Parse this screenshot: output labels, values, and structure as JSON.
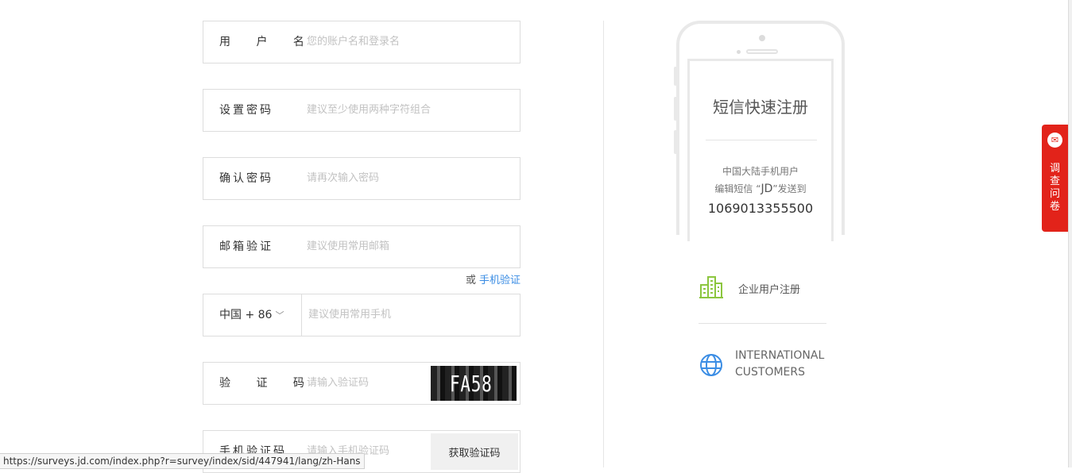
{
  "form": {
    "username": {
      "label": "用 户 名",
      "placeholder": "您的账户名和登录名"
    },
    "password": {
      "label": "设置密码",
      "placeholder": "建议至少使用两种字符组合"
    },
    "confirm": {
      "label": "确认密码",
      "placeholder": "请再次输入密码"
    },
    "email": {
      "label": "邮箱验证",
      "placeholder": "建议使用常用邮箱"
    },
    "alt_prefix": "或",
    "alt_link": "手机验证",
    "phone": {
      "country": "中国 + 86",
      "placeholder": "建议使用常用手机"
    },
    "captcha": {
      "label": "验 证 码",
      "placeholder": "请输入验证码",
      "image_text": "FA58"
    },
    "sms_code": {
      "label": "手机验证码",
      "placeholder": "请输入手机验证码",
      "button": "获取验证码"
    }
  },
  "sidebar": {
    "sms_title": "短信快速注册",
    "sms_line1": "中国大陆手机用户",
    "sms_line2_prefix": "编辑短信 “",
    "sms_keyword": "JD",
    "sms_line2_suffix": "”发送到",
    "sms_number": "1069013355500",
    "enterprise": "企业用户注册",
    "international_line1": "INTERNATIONAL",
    "international_line2": "CUSTOMERS"
  },
  "survey_tab": {
    "label": "调查问卷",
    "icon": "survey-icon"
  },
  "status_bar": {
    "url": "https://surveys.jd.com/index.php?r=survey/index/sid/447941/lang/zh-Hans"
  },
  "colors": {
    "accent": "#e2231a",
    "link": "#3b8de4",
    "enterprise_icon": "#8cc63f",
    "globe_icon": "#3b8de4"
  }
}
